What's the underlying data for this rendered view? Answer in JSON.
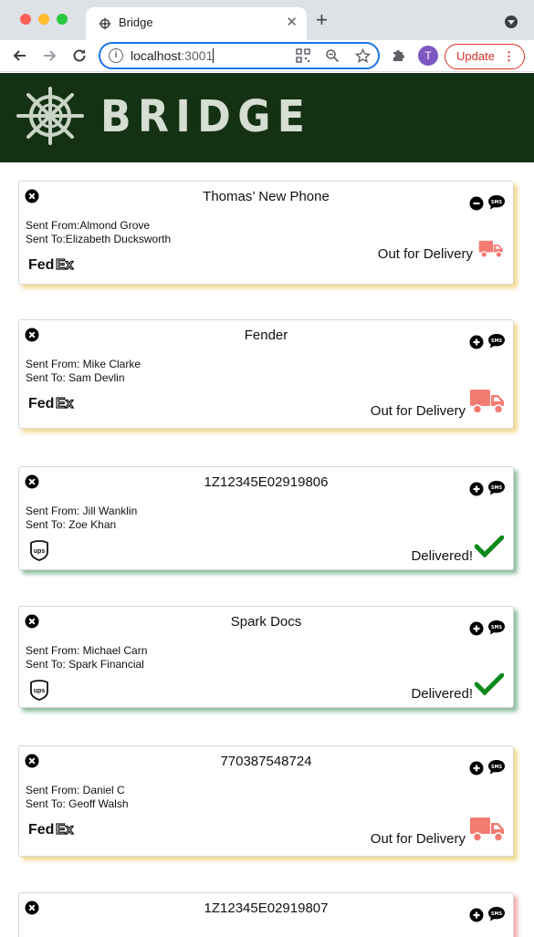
{
  "browser": {
    "tab_title": "Bridge",
    "url_host": "localhost",
    "url_port": ":3001",
    "avatar_initial": "T",
    "update_label": "Update"
  },
  "app": {
    "logo_text": "BRIDGE"
  },
  "colors": {
    "header_bg": "#143213",
    "out_for_delivery": "#f47b72",
    "delivered": "#0a8a1a"
  },
  "shipments": [
    {
      "title": "Thomas’ New Phone",
      "sent_from": "Sent From:Almond Grove",
      "sent_to": "Sent To:Elizabeth Ducksworth",
      "carrier": "FedEx",
      "status": "Out for Delivery",
      "expanded": true
    },
    {
      "title": "Fender",
      "sent_from": "Sent From: Mike Clarke",
      "sent_to": "Sent To: Sam Devlin",
      "carrier": "FedEx",
      "status": "Out for Delivery",
      "expanded": false
    },
    {
      "title": "1Z12345E02919806",
      "sent_from": "Sent From: Jill Wanklin",
      "sent_to": "Sent To: Zoe Khan",
      "carrier": "UPS",
      "status": "Delivered!",
      "expanded": false
    },
    {
      "title": "Spark Docs",
      "sent_from": "Sent From: Michael Carn",
      "sent_to": "Sent To: Spark Financial",
      "carrier": "UPS",
      "status": "Delivered!",
      "expanded": false
    },
    {
      "title": "770387548724",
      "sent_from": "Sent From: Daniel C",
      "sent_to": "Sent To: Geoff Walsh",
      "carrier": "FedEx",
      "status": "Out for Delivery",
      "expanded": false
    },
    {
      "title": "1Z12345E02919807",
      "sent_from": "",
      "sent_to": "",
      "carrier": "",
      "status": "",
      "expanded": false
    }
  ]
}
